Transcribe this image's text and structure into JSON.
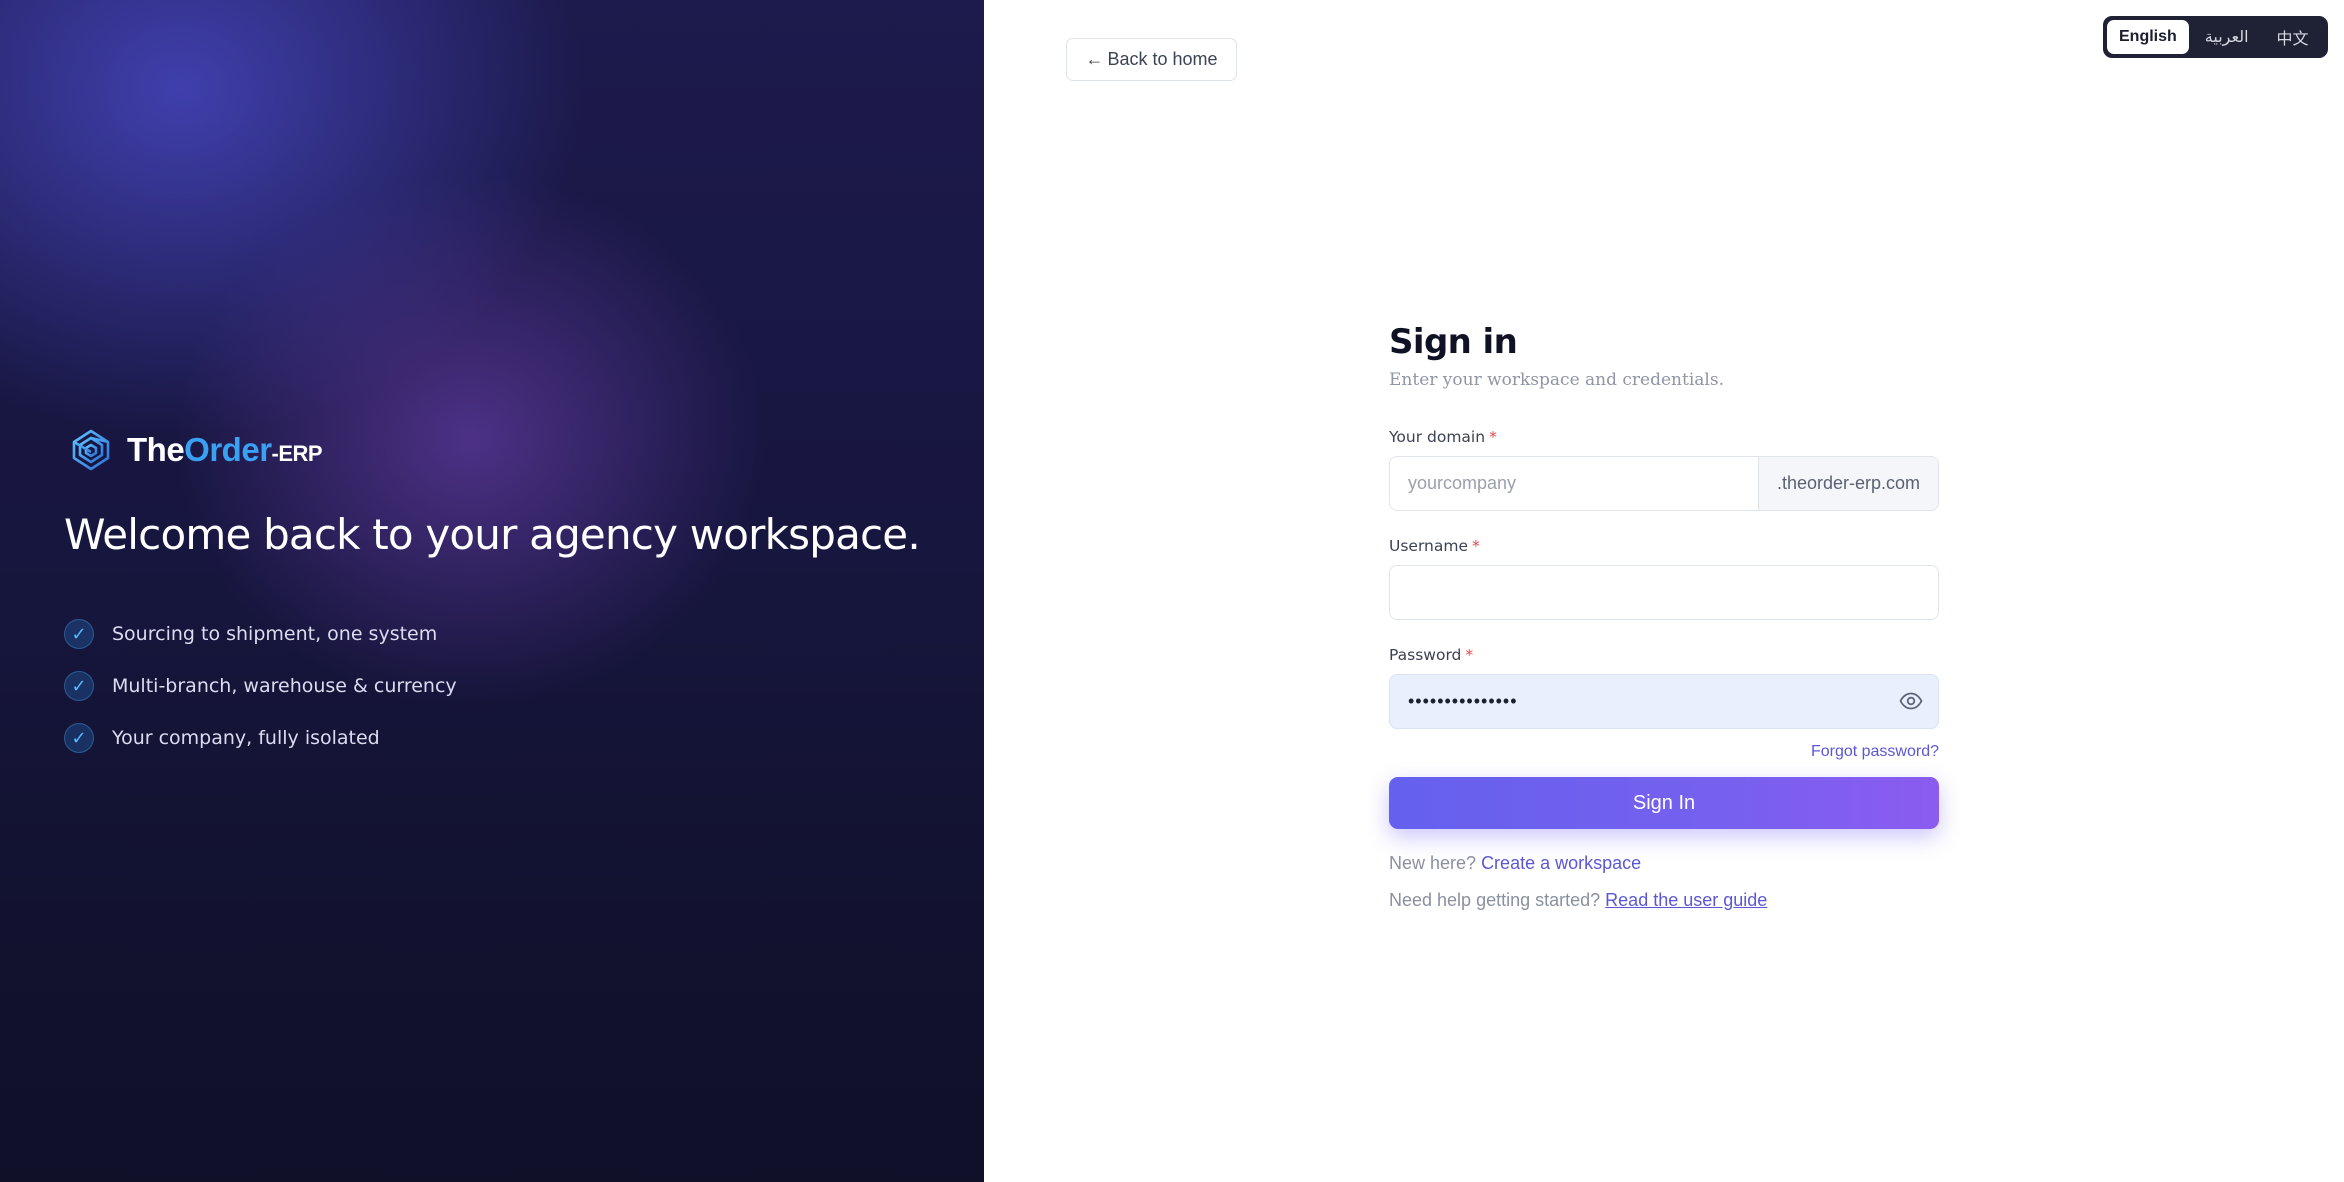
{
  "hero": {
    "brand": {
      "the": "The",
      "order": "Order",
      "erp": "-ERP"
    },
    "welcome": "Welcome back to your agency workspace.",
    "features": [
      "Sourcing to shipment, one system",
      "Multi-branch, warehouse & currency",
      "Your company, fully isolated"
    ]
  },
  "nav": {
    "back_label": "Back to home",
    "back_arrow": "←"
  },
  "languages": {
    "active": "English",
    "options": [
      "English",
      "العربية",
      "中文"
    ]
  },
  "form": {
    "title": "Sign in",
    "subtitle": "Enter your workspace and credentials.",
    "domain": {
      "label": "Your domain",
      "required": "*",
      "placeholder": "yourcompany",
      "value": "",
      "suffix": ".theorder-erp.com"
    },
    "username": {
      "label": "Username",
      "required": "*",
      "value": ""
    },
    "password": {
      "label": "Password",
      "required": "*",
      "value": "•••••••••••••••"
    },
    "forgot": "Forgot password?",
    "submit": "Sign In",
    "new_here": "New here?",
    "create_workspace": "Create a workspace",
    "need_help": "Need help getting started?",
    "user_guide": "Read the user guide"
  },
  "icons": {
    "logo": "theorder-logo-icon",
    "check": "check-icon",
    "eye": "eye-icon"
  }
}
